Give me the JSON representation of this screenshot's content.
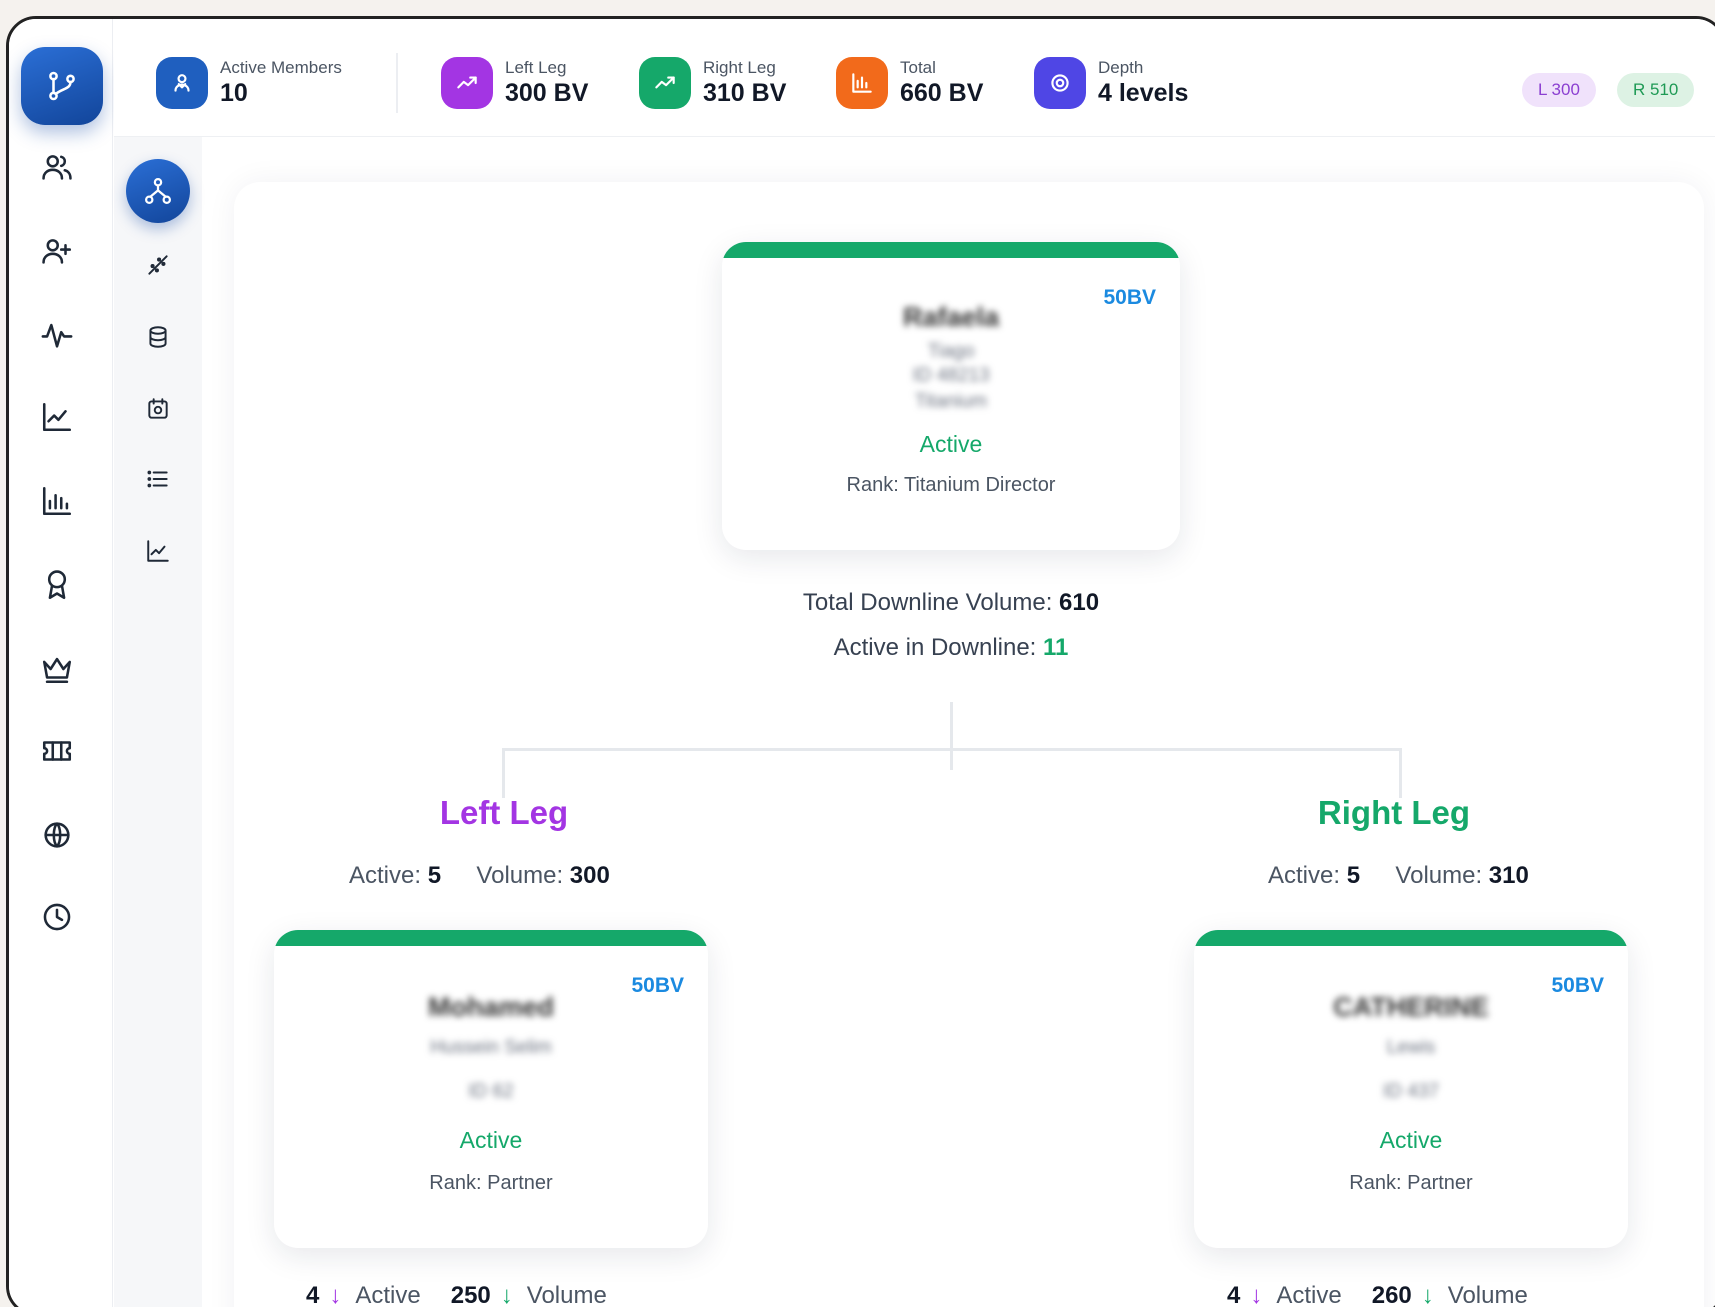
{
  "stats": {
    "active_members": {
      "label": "Active Members",
      "value": "10",
      "color": "#1f5fbf"
    },
    "left_leg": {
      "label": "Left Leg",
      "value": "300 BV",
      "color": "#a335e3"
    },
    "right_leg": {
      "label": "Right Leg",
      "value": "310 BV",
      "color": "#15a86a"
    },
    "total": {
      "label": "Total",
      "value": "660 BV",
      "color": "#f26a1b"
    },
    "depth": {
      "label": "Depth",
      "value": "4 levels",
      "color": "#4f46e5"
    }
  },
  "pills": {
    "left": "L 300",
    "right": "R 510"
  },
  "root": {
    "bv": "50BV",
    "name": "Rafaela",
    "sub1": "Tiago",
    "sub2": "ID 48213",
    "sub3": "Titanium",
    "status": "Active",
    "rank": "Rank: Titanium Director"
  },
  "downline": {
    "volume_label": "Total Downline Volume:",
    "volume_value": "610",
    "active_label": "Active in Downline:",
    "active_value": "11"
  },
  "left": {
    "title": "Left Leg",
    "active_label": "Active:",
    "active_value": "5",
    "volume_label": "Volume:",
    "volume_value": "300",
    "node": {
      "bv": "50BV",
      "name": "Mohamed",
      "sub1": "Hussein Selim",
      "sub2": "ID 62",
      "status": "Active",
      "rank": "Rank: Partner"
    },
    "foot": {
      "active_count": "4",
      "active_label": "Active",
      "volume_value": "250",
      "volume_label": "Volume"
    }
  },
  "right": {
    "title": "Right Leg",
    "active_label": "Active:",
    "active_value": "5",
    "volume_label": "Volume:",
    "volume_value": "310",
    "node": {
      "bv": "50BV",
      "name": "CATHERINE",
      "sub1": "Lewis",
      "sub2": "ID 437",
      "status": "Active",
      "rank": "Rank: Partner"
    },
    "foot": {
      "active_count": "4",
      "active_label": "Active",
      "volume_value": "260",
      "volume_label": "Volume"
    }
  },
  "icons": {
    "rail": [
      "binary-tree-icon",
      "users-icon",
      "user-add-icon",
      "activity-icon",
      "line-chart-icon",
      "bar-chart-icon",
      "award-icon",
      "crown-icon",
      "ticket-icon",
      "globe-icon",
      "clock-icon"
    ],
    "subrail": [
      "hierarchy-icon",
      "scatter-icon",
      "database-icon",
      "calendar-icon",
      "list-icon",
      "trend-icon"
    ]
  }
}
